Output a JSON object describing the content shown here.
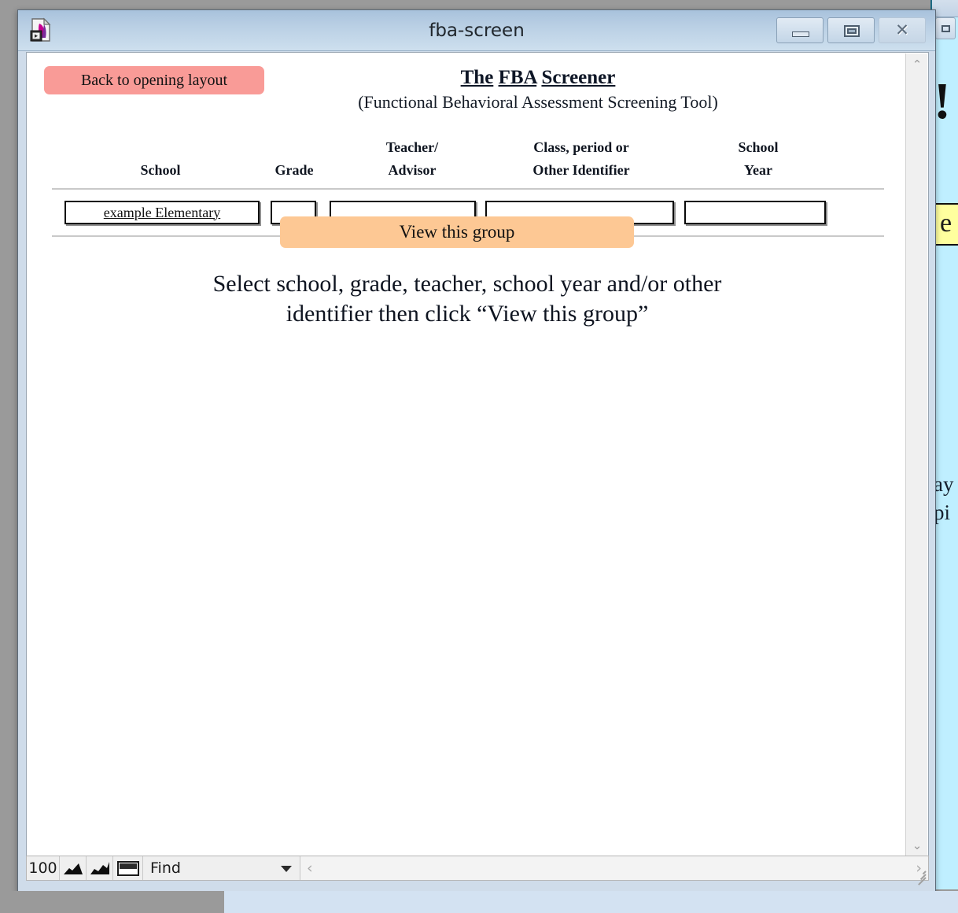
{
  "window": {
    "title": "fba-screen",
    "icon": "filemaker-document-icon",
    "controls": {
      "minimize": "—",
      "restore": "▣",
      "close": "✕"
    }
  },
  "background_window": {
    "exclamation": "!",
    "yellow_field_text": "e",
    "fragment_1": "ay",
    "fragment_2": "pi"
  },
  "layout": {
    "back_button": "Back to opening layout",
    "title_line1": "The",
    "title_line2": "FBA",
    "title_line3": "Screener",
    "subtitle": "(Functional Behavioral Assessment Screening Tool)",
    "view_button": "View this group",
    "instruction_line1": "Select school, grade, teacher, school year and/or other",
    "instruction_line2": "identifier then click “View this group”"
  },
  "table": {
    "headers": [
      {
        "label": "School",
        "line1": "",
        "line2": "School"
      },
      {
        "label": "Grade",
        "line1": "",
        "line2": "Grade"
      },
      {
        "label": "Teacher/Advisor",
        "line1": "Teacher/",
        "line2": "Advisor"
      },
      {
        "label": "Class, period or Other Identifier",
        "line1": "Class, period or",
        "line2": "Other Identifier"
      },
      {
        "label": "School Year",
        "line1": "School",
        "line2": "Year"
      }
    ],
    "row": {
      "school": "example Elementary",
      "grade": "",
      "teacher_advisor": "",
      "class_period_other": "",
      "school_year": ""
    }
  },
  "statusbar": {
    "zoom_level": "100",
    "zoom_out_icon": "zoom-out-icon",
    "zoom_in_icon": "zoom-in-icon",
    "status_toggle_icon": "status-area-toggle-icon",
    "mode": "Find",
    "dropdown_icon": "chevron-down-icon",
    "hscroll_left": "‹",
    "hscroll_right": "›"
  },
  "scrollbar": {
    "up_icon": "⌃",
    "down_icon": "⌄"
  },
  "colors": {
    "back_button_bg": "#f99b97",
    "view_button_bg": "#fdc894",
    "titlebar": "#b9cfe4",
    "bg_window": "#bfefff",
    "yellow_field": "#ffff9e"
  }
}
